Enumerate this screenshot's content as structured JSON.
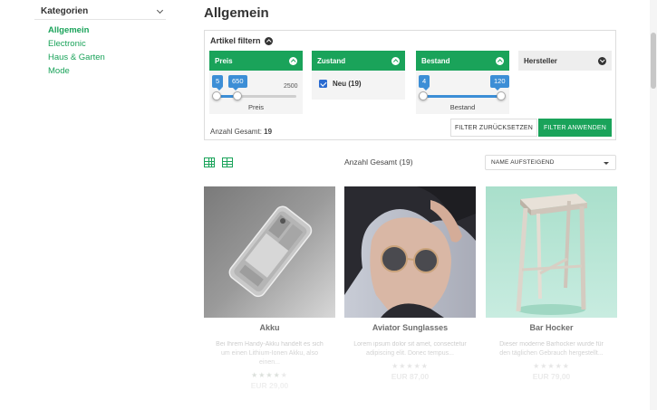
{
  "sidebar": {
    "title": "Kategorien",
    "items": [
      {
        "label": "Allgemein"
      },
      {
        "label": "Electronic"
      },
      {
        "label": "Haus & Garten"
      },
      {
        "label": "Mode"
      }
    ]
  },
  "page": {
    "title": "Allgemein"
  },
  "filter": {
    "heading": "Artikel filtern",
    "preis": {
      "label": "Preis",
      "min_value": "5",
      "max_value": "650",
      "range_max": "2500",
      "caption": "Preis"
    },
    "zustand": {
      "label": "Zustand",
      "option_label": "Neu (19)",
      "checked": true
    },
    "bestand": {
      "label": "Bestand",
      "min_value": "4",
      "max_value": "120",
      "caption": "Bestand"
    },
    "hersteller": {
      "label": "Hersteller"
    },
    "total_label": "Anzahl Gesamt:",
    "total_value": "19",
    "reset_label": "FILTER ZURÜCKSETZEN",
    "apply_label": "FILTER ANWENDEN"
  },
  "toolbar": {
    "count_text": "Anzahl Gesamt (19)",
    "sort_value": "NAME AUFSTEIGEND",
    "view_icons": [
      "grid-view-icon",
      "list-view-icon"
    ]
  },
  "products": [
    {
      "name": "Akku",
      "desc": "Bei Ihrem Handy-Akku handelt es sich um einen Lithium-Ionen Akku, also einen...",
      "rating": 4,
      "price": "EUR 29,00"
    },
    {
      "name": "Aviator Sunglasses",
      "desc": "Lorem ipsum dolor sit amet, consectetur adipiscing elit. Donec tempus...",
      "rating": 0,
      "price": "EUR 87,00"
    },
    {
      "name": "Bar Hocker",
      "desc": "Dieser moderne Barhocker wurde für den täglichen Gebrauch hergestellt...",
      "rating": 0,
      "price": "EUR 79,00"
    }
  ],
  "colors": {
    "accent": "#1aa35a",
    "slider": "#3c8ed6",
    "checkbox": "#2a6bd1"
  }
}
